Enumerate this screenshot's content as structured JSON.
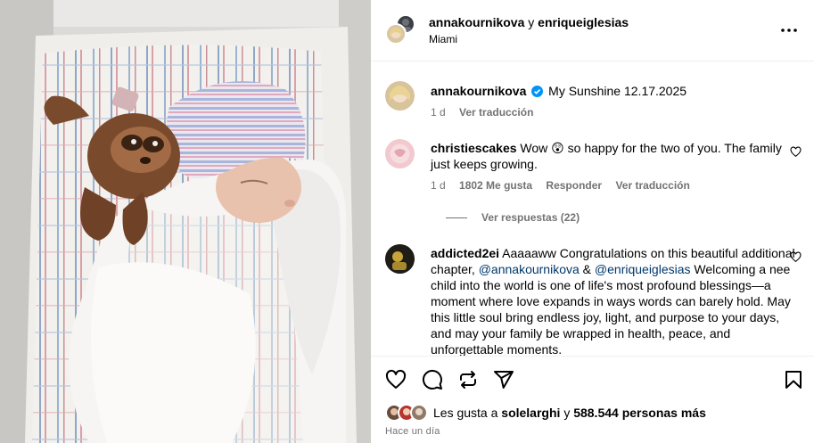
{
  "post": {
    "authors": [
      "annakournikova",
      "enriqueiglesias"
    ],
    "authors_joiner": "y",
    "location": "Miami"
  },
  "caption": {
    "username": "annakournikova",
    "verified": true,
    "text": "My Sunshine 12.17.2025",
    "age": "1 d",
    "translate": "Ver traducción"
  },
  "comments": [
    {
      "username": "christiescakes",
      "text_before": "Wow",
      "emoji": "😲",
      "text_after": "so happy for the two of you. The family just keeps growing.",
      "age": "1 d",
      "likes": "1802 Me gusta",
      "reply": "Responder",
      "translate": "Ver traducción",
      "view_replies": "Ver respuestas (22)"
    },
    {
      "username": "addicted2ei",
      "text_before": "Aaaaaww Congratulations on this beautiful additional chapter,",
      "mention1": "@annakournikova",
      "amp": "&",
      "mention2": "@enriqueiglesias",
      "text_after": "Welcoming a nee child into the world is one of life's most profound blessings—a moment where love expands in ways words can barely hold. May this little soul bring endless joy, light, and purpose to your days, and may your family be wrapped in health, peace, and unforgettable moments."
    }
  ],
  "likes_line": {
    "prefix": "Les gusta a",
    "user": "solelarghi",
    "joiner": "y",
    "others": "588.544 personas más"
  },
  "timestamp": "Hace un día",
  "icons": {
    "more": "more-horizontal-icon",
    "like": "heart-icon",
    "comment": "comment-bubble-icon",
    "repost": "repost-icon",
    "share": "send-icon",
    "save": "bookmark-icon",
    "verified": "verified-badge-icon"
  },
  "colors": {
    "verified": "#0095f6",
    "mention": "#00376b",
    "muted": "#737373",
    "divider": "#efefef"
  }
}
